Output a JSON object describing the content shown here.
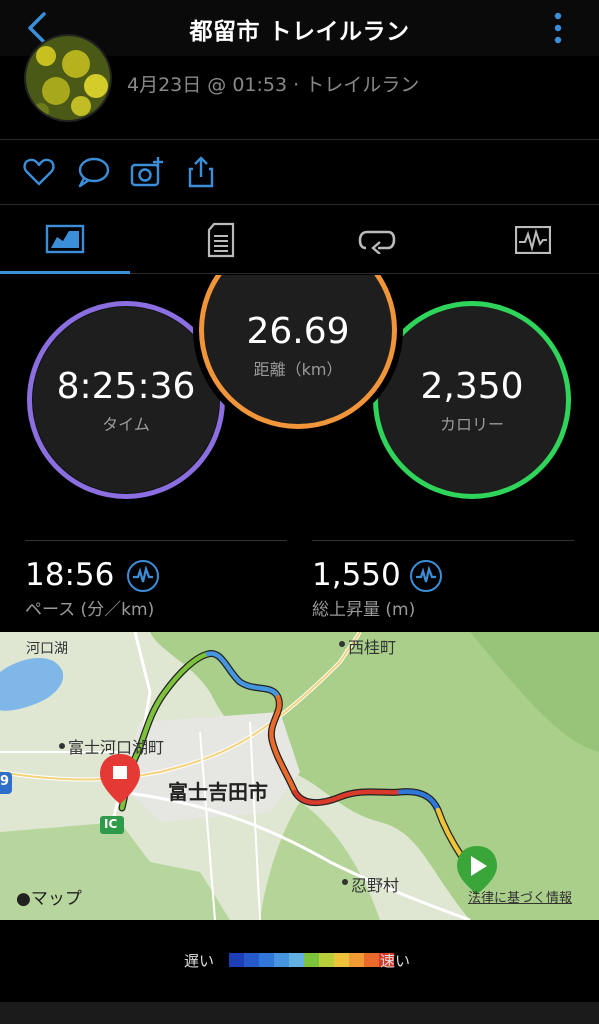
{
  "header": {
    "title": "都留市 トレイルラン"
  },
  "summary": {
    "subtitle": "4月23日 @ 01:53 · トレイルラン"
  },
  "stats": {
    "time": {
      "value": "8:25:36",
      "label": "タイム",
      "color": "#8b6fe0"
    },
    "distance": {
      "value": "26.69",
      "label": "距離（km）",
      "color": "#f0953a"
    },
    "calories": {
      "value": "2,350",
      "label": "カロリー",
      "color": "#2fd45a"
    }
  },
  "metrics": {
    "pace": {
      "value": "18:56",
      "label": "ペース (分／km)"
    },
    "elevation": {
      "value": "1,550",
      "label": "総上昇量 (m)"
    }
  },
  "map": {
    "labels": {
      "lake": "河口湖",
      "town1": "富士河口湖町",
      "city": "富士吉田市",
      "town2": "西桂町",
      "village": "忍野村",
      "ic": "IC",
      "brand": "マップ",
      "legal": "法律に基づく情報",
      "route9": "9"
    }
  },
  "legend": {
    "slow": "遅い",
    "fast": "速い"
  },
  "colors": {
    "accent": "#3b8fd9",
    "legend_scale": [
      "#1d3fb5",
      "#2559cc",
      "#2f78da",
      "#4596df",
      "#62b0e0",
      "#7cc23b",
      "#b6cf3a",
      "#f0c43a",
      "#f29a33",
      "#ea6a2c",
      "#d83b2b"
    ]
  },
  "icons": [
    "back-icon",
    "more-icon",
    "heart-icon",
    "comment-icon",
    "add-photo-icon",
    "share-icon",
    "stats-tab-icon",
    "details-tab-icon",
    "laps-tab-icon",
    "chart-tab-icon"
  ]
}
